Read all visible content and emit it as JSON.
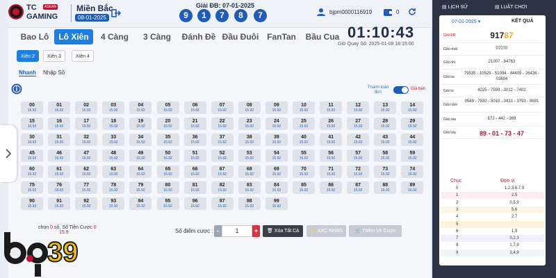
{
  "header": {
    "brand_top": "TC",
    "brand_badge": "ASEAN",
    "brand_bottom": "GAMING",
    "region": "Miền Bắc",
    "region_date": "08-01-2025",
    "gdb_label": "Giải ĐB: 07-01-2025",
    "gdb_balls": [
      "9",
      "1",
      "7",
      "8",
      "7"
    ],
    "username": "bjpm0000116919",
    "wallet": "0"
  },
  "tabs": [
    "Bao Lô",
    "Lô Xiên",
    "4 Càng",
    "3 Càng",
    "Đánh Đề",
    "Đầu Đuôi",
    "FanTan",
    "Bầu Cua"
  ],
  "timer": "01:10:43",
  "draw_time": "Giờ Quay Số: 2025-01-08 18:15:00",
  "subtabs": [
    "Xiên 2",
    "Xiên 3",
    "Xiên 4"
  ],
  "modes": [
    "Nhanh",
    "Nhập Số"
  ],
  "toggle": {
    "left": "Thanh toán đơn",
    "right": "Giá bán"
  },
  "rate": "15.92",
  "numbers": [
    "00",
    "01",
    "02",
    "03",
    "04",
    "05",
    "06",
    "07",
    "08",
    "09",
    "10",
    "11",
    "12",
    "13",
    "14",
    "15",
    "16",
    "17",
    "18",
    "19",
    "20",
    "21",
    "22",
    "23",
    "24",
    "25",
    "26",
    "27",
    "28",
    "29",
    "30",
    "31",
    "32",
    "33",
    "34",
    "35",
    "36",
    "37",
    "38",
    "39",
    "40",
    "41",
    "42",
    "43",
    "44",
    "45",
    "46",
    "47",
    "48",
    "49",
    "50",
    "51",
    "52",
    "53",
    "54",
    "55",
    "56",
    "57",
    "58",
    "59",
    "60",
    "61",
    "62",
    "63",
    "64",
    "65",
    "66",
    "67",
    "68",
    "69",
    "70",
    "71",
    "72",
    "73",
    "74",
    "75",
    "76",
    "77",
    "78",
    "79",
    "80",
    "81",
    "82",
    "83",
    "84",
    "85",
    "86",
    "87",
    "88",
    "89",
    "90",
    "91",
    "92",
    "93",
    "94",
    "95",
    "96",
    "97",
    "98",
    "99"
  ],
  "footer": {
    "chon_label": "chọn",
    "chon_value": "0",
    "chon_unit": "số,",
    "tien_label": "Số Tiền Cược",
    "tien_value": "0",
    "partial": "15.9",
    "diem_label": "Số điểm cược :",
    "diem_value": "1",
    "btn_clear": "Xóa Tất Cả",
    "btn_confirm": "XÁC NHẬN",
    "btn_cart": "Thêm Vé Cược"
  },
  "watermark": "bj39",
  "results": {
    "history": "LỊCH SỬ",
    "rules": "LUẬT CHƠI",
    "date": "07-01-2025",
    "title": "KẾT QUẢ",
    "prizes": [
      {
        "label": "Giải ĐB",
        "value": "91787"
      },
      {
        "label": "Giải nhất",
        "value": "07070"
      },
      {
        "label": "Giải nhì",
        "value": "21007 - 84763"
      },
      {
        "label": "Giải ba",
        "value": "79535 - 10529 - 51094 - 84405 - 26436 - 03694"
      },
      {
        "label": "Giải tư",
        "value": "4225 - 7599 - 3012 - 7402"
      },
      {
        "label": "Giải năm",
        "value": "0589 - 7830 - 5015 - 3431 - 3793 - 8691"
      },
      {
        "label": "Giải sáu",
        "value": "572 - 442 - 369"
      },
      {
        "label": "Giải bảy",
        "value": "89 - 01 - 73 - 47"
      }
    ],
    "dau_header": "Chục",
    "duoi_header": "Đơn vị",
    "dau": [
      {
        "k": "0",
        "v": "1,2,3,6,7,9"
      },
      {
        "k": "1",
        "v": "2,5"
      },
      {
        "k": "2",
        "v": "0,5,9"
      },
      {
        "k": "3",
        "v": "5,6"
      },
      {
        "k": "4",
        "v": "2,7"
      },
      {
        "k": "5",
        "v": ""
      },
      {
        "k": "6",
        "v": "1,9"
      },
      {
        "k": "7",
        "v": "0,2,3"
      },
      {
        "k": "8",
        "v": "1,7,9"
      },
      {
        "k": "9",
        "v": "3,4,9"
      }
    ]
  }
}
